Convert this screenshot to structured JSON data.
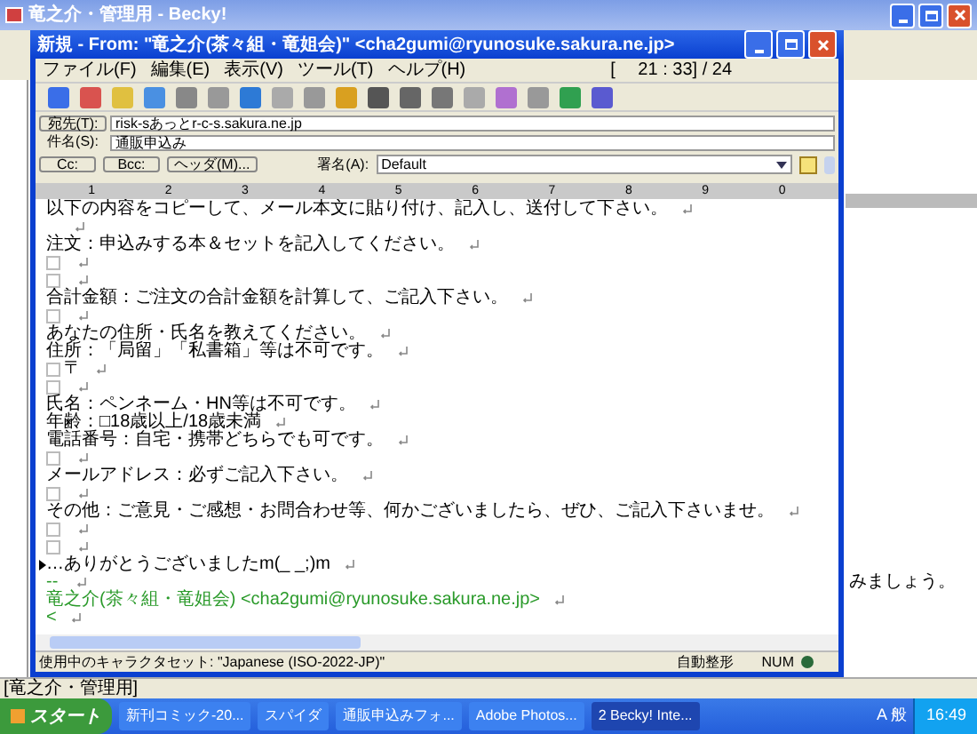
{
  "main_window": {
    "title": "竜之介・管理用 - Becky!",
    "background_text": "みましょう。",
    "status": "[竜之介・管理用]"
  },
  "compose": {
    "title": "新規 - From: \"竜之介(茶々組・竜姐会)\" <cha2gumi@ryunosuke.sakura.ne.jp>",
    "menu": [
      "ファイル(F)",
      "編集(E)",
      "表示(V)",
      "ツール(T)",
      "ヘルプ(H)"
    ],
    "position": "[　 21 : 33] / 24",
    "to": {
      "label": "宛先(T):",
      "value": "risk-sあっとr-c-s.sakura.ne.jp"
    },
    "subject": {
      "label": "件名(S):",
      "value": "通販申込み"
    },
    "buttons": [
      "Cc:",
      "Bcc:",
      "ヘッダ(M)..."
    ],
    "signature": {
      "label": "署名(A):",
      "value": "Default"
    },
    "ruler": [
      "1",
      "2",
      "3",
      "4",
      "5",
      "6",
      "7",
      "8",
      "9",
      "0"
    ],
    "body": [
      {
        "kind": "text",
        "text": "以下の内容をコピーして、メール本文に貼り付け、記入し、送付して下さい。"
      },
      {
        "kind": "blank"
      },
      {
        "kind": "text",
        "text": "注文：申込みする本＆セットを記入してください。"
      },
      {
        "kind": "box"
      },
      {
        "kind": "box"
      },
      {
        "kind": "text",
        "text": "合計金額：ご注文の合計金額を計算して、ご記入下さい。"
      },
      {
        "kind": "box"
      },
      {
        "kind": "text",
        "text": "あなたの住所・氏名を教えてください。"
      },
      {
        "kind": "text",
        "text": "住所：「局留」「私書箱」等は不可です。"
      },
      {
        "kind": "box",
        "text": "〒"
      },
      {
        "kind": "box"
      },
      {
        "kind": "text",
        "text": "氏名：ペンネーム・HN等は不可です。"
      },
      {
        "kind": "text",
        "text": "年齢：□18歳以上/18歳未満"
      },
      {
        "kind": "text",
        "text": "電話番号：自宅・携帯どちらでも可です。"
      },
      {
        "kind": "box"
      },
      {
        "kind": "text",
        "text": "メールアドレス：必ずご記入下さい。"
      },
      {
        "kind": "box"
      },
      {
        "kind": "text",
        "text": "その他：ご意見・ご感想・お問合わせ等、何かございましたら、ぜひ、ご記入下さいませ。"
      },
      {
        "kind": "box"
      },
      {
        "kind": "box"
      },
      {
        "kind": "cursor",
        "text": "…ありがとうございましたm(_ _;)m"
      },
      {
        "kind": "signature",
        "text": "-- "
      },
      {
        "kind": "signature",
        "text": "竜之介(茶々組・竜姐会) <cha2gumi@ryunosuke.sakura.ne.jp>"
      },
      {
        "kind": "signature",
        "text": "<"
      }
    ],
    "status": {
      "charset": "使用中のキャラクタセット: \"Japanese (ISO-2022-JP)\"",
      "wrap": "自動整形",
      "num": "NUM"
    }
  },
  "taskbar": {
    "start": "スタート",
    "tasks": [
      {
        "label": "新刊コミック-20...",
        "selected": false
      },
      {
        "label": "スパイダ",
        "selected": false
      },
      {
        "label": "通販申込みフォ...",
        "selected": false
      },
      {
        "label": "Adobe Photos...",
        "selected": false
      },
      {
        "label": "2 Becky! Inte...",
        "selected": true
      }
    ],
    "ime": "A 般",
    "time": "16:49"
  }
}
